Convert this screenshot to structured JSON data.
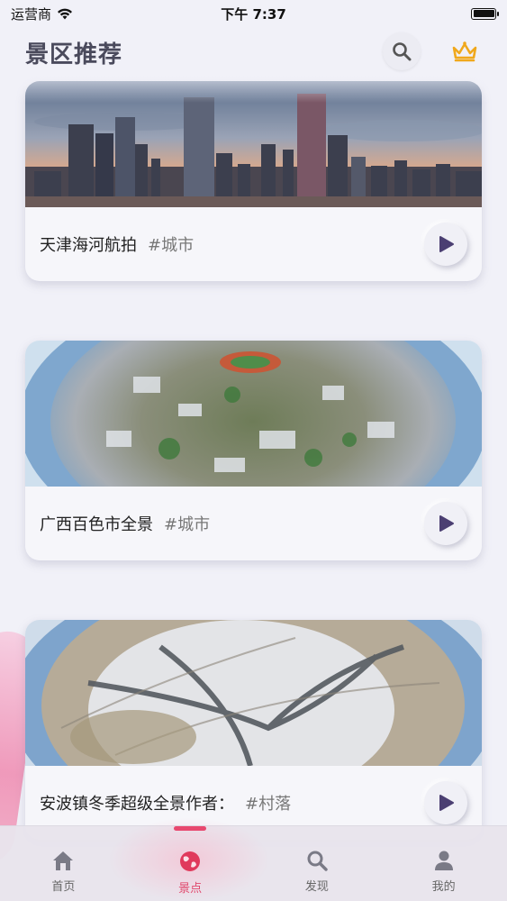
{
  "status_bar": {
    "carrier": "运营商",
    "time": "下午 7:37"
  },
  "header": {
    "title": "景区推荐",
    "search_icon": "search-icon",
    "vip_icon": "crown-icon"
  },
  "cards": [
    {
      "title": "天津海河航拍",
      "tag": "#城市",
      "image": "city-skyline-photo",
      "play_icon": "play-icon"
    },
    {
      "title": "广西百色市全景",
      "tag": "#城市",
      "image": "tiny-planet-city-photo",
      "play_icon": "play-icon"
    },
    {
      "title": "安波镇冬季超级全景作者：",
      "tag": "#村落",
      "image": "tiny-planet-snow-highway-photo",
      "play_icon": "play-icon"
    }
  ],
  "tab_bar": {
    "tabs": [
      {
        "label": "首页",
        "icon": "home-icon",
        "active": false
      },
      {
        "label": "景点",
        "icon": "globe-icon",
        "active": true
      },
      {
        "label": "发现",
        "icon": "search-icon",
        "active": false
      },
      {
        "label": "我的",
        "icon": "person-icon",
        "active": false
      }
    ]
  },
  "colors": {
    "accent": "#e8486f",
    "play_triangle": "#4b3f72",
    "crown": "#f0a81c"
  }
}
